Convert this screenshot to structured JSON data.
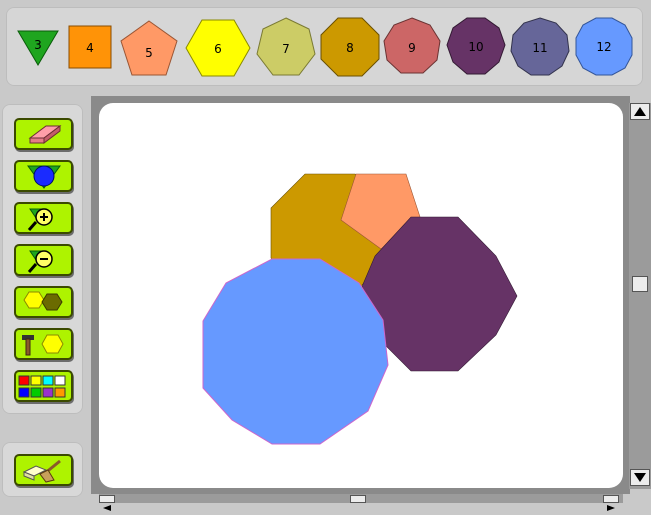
{
  "shape_palette": [
    {
      "sides": "3",
      "label": "3",
      "color": "#1fa51f"
    },
    {
      "sides": "4",
      "label": "4",
      "color": "#ff9307"
    },
    {
      "sides": "5",
      "label": "5",
      "color": "#ff9966"
    },
    {
      "sides": "6",
      "label": "6",
      "color": "#ffff00"
    },
    {
      "sides": "7",
      "label": "7",
      "color": "#cccc66"
    },
    {
      "sides": "8",
      "label": "8",
      "color": "#cc9900"
    },
    {
      "sides": "9",
      "label": "9",
      "color": "#cc6666"
    },
    {
      "sides": "10",
      "label": "10",
      "color": "#663366"
    },
    {
      "sides": "11",
      "label": "11",
      "color": "#666699"
    },
    {
      "sides": "12",
      "label": "12",
      "color": "#6699ff"
    }
  ],
  "tools": [
    {
      "name": "eraser",
      "icon": "eraser-icon"
    },
    {
      "name": "fill",
      "icon": "fill-shape-icon"
    },
    {
      "name": "zoom-in",
      "icon": "zoom-in-icon"
    },
    {
      "name": "zoom-out",
      "icon": "zoom-out-icon"
    },
    {
      "name": "duplicate",
      "icon": "duplicate-shape-icon"
    },
    {
      "name": "hammer",
      "icon": "hammer-icon"
    },
    {
      "name": "color-palette",
      "icon": "color-palette-icon"
    }
  ],
  "bottom_tool": {
    "name": "clear-canvas",
    "icon": "broom-icon"
  },
  "canvas_shapes": [
    {
      "sides": 8,
      "color": "#cc9900"
    },
    {
      "sides": 5,
      "color": "#ff9966"
    },
    {
      "sides": 10,
      "color": "#663366"
    },
    {
      "sides": 12,
      "color": "#6699ff"
    }
  ],
  "colors": {
    "tool_button": "#aef300",
    "canvas": "#ffffff",
    "frame": "#8a8a8a"
  }
}
